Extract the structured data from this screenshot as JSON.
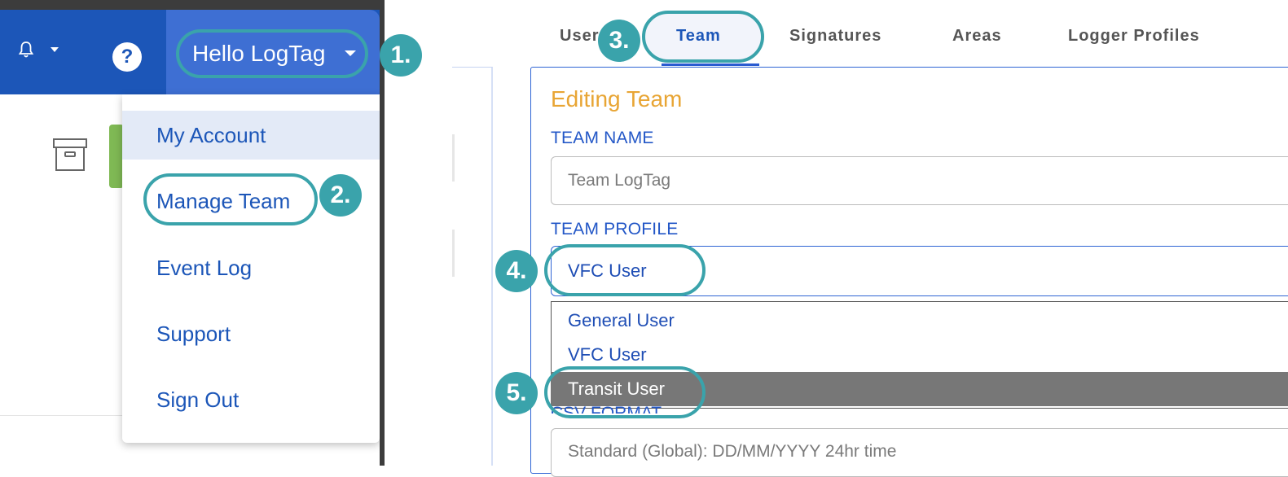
{
  "header": {
    "bell_icon": "bell-icon",
    "help_icon": "help-icon",
    "help_glyph": "?",
    "greeting": "Hello LogTag"
  },
  "user_menu": {
    "items": [
      {
        "label": "My Account"
      },
      {
        "label": "Manage Team"
      },
      {
        "label": "Event Log"
      },
      {
        "label": "Support"
      },
      {
        "label": "Sign Out"
      }
    ],
    "active_index": 0
  },
  "tabs": [
    {
      "label": "User"
    },
    {
      "label": "Team"
    },
    {
      "label": "Signatures"
    },
    {
      "label": "Areas"
    },
    {
      "label": "Logger Profiles"
    }
  ],
  "selected_tab": "Team",
  "form": {
    "title": "Editing Team",
    "team_name_label": "TEAM NAME",
    "team_name_value": "Team LogTag",
    "team_profile_label": "TEAM PROFILE",
    "team_profile_value": "VFC User",
    "profile_options": [
      "General User",
      "VFC User",
      "Transit User"
    ],
    "highlighted_option": "Transit User",
    "csv_format_label": "CSV FORMAT",
    "csv_format_value": "Standard (Global): DD/MM/YYYY 24hr time"
  },
  "annotations": {
    "badges": [
      "1.",
      "2.",
      "3.",
      "4.",
      "5."
    ]
  },
  "colors": {
    "nav_blue": "#1c56b8",
    "nav_user_blue": "#3e6fd3",
    "link_blue": "#1c56b8",
    "title_orange": "#e8a534",
    "annotation_teal": "#3aa3ab",
    "selected_option_gray": "#777777"
  }
}
